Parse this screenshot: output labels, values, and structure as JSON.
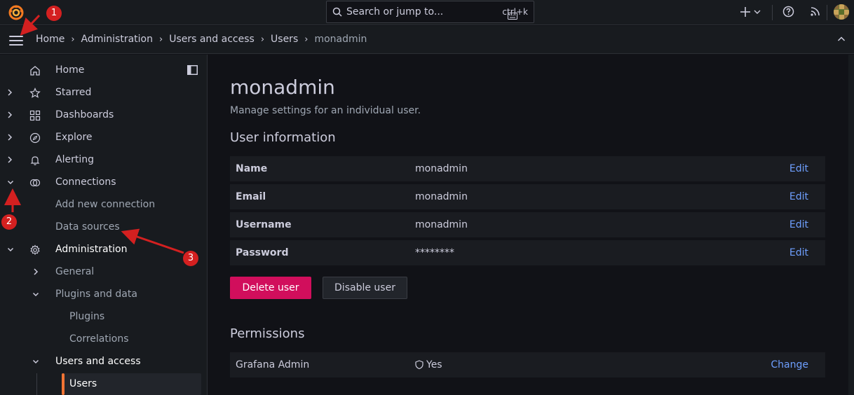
{
  "search": {
    "placeholder": "Search or jump to...",
    "shortcut": "ctrl+k"
  },
  "breadcrumb": {
    "home": "Home",
    "admin": "Administration",
    "users_access": "Users and access",
    "users": "Users",
    "current": "monadmin"
  },
  "sidebar": {
    "items": [
      {
        "label": "Home"
      },
      {
        "label": "Starred"
      },
      {
        "label": "Dashboards"
      },
      {
        "label": "Explore"
      },
      {
        "label": "Alerting"
      },
      {
        "label": "Connections"
      },
      {
        "label": "Add new connection"
      },
      {
        "label": "Data sources"
      },
      {
        "label": "Administration"
      },
      {
        "label": "General"
      },
      {
        "label": "Plugins and data"
      },
      {
        "label": "Plugins"
      },
      {
        "label": "Correlations"
      },
      {
        "label": "Users and access"
      },
      {
        "label": "Users"
      }
    ]
  },
  "page": {
    "title": "monadmin",
    "subtitle": "Manage settings for an individual user.",
    "user_info_title": "User information",
    "rows": [
      {
        "key": "Name",
        "value": "monadmin",
        "action": "Edit"
      },
      {
        "key": "Email",
        "value": "monadmin",
        "action": "Edit"
      },
      {
        "key": "Username",
        "value": "monadmin",
        "action": "Edit"
      },
      {
        "key": "Password",
        "value": "********",
        "action": "Edit"
      }
    ],
    "delete_label": "Delete user",
    "disable_label": "Disable user",
    "permissions_title": "Permissions",
    "permission": {
      "key": "Grafana Admin",
      "value": "Yes",
      "action": "Change"
    }
  },
  "annotations": {
    "one": "1",
    "two": "2",
    "three": "3"
  },
  "colors": {
    "accent": "#f17434",
    "danger": "#d10e5c",
    "link": "#6e9fff",
    "annotation": "#d42020"
  }
}
